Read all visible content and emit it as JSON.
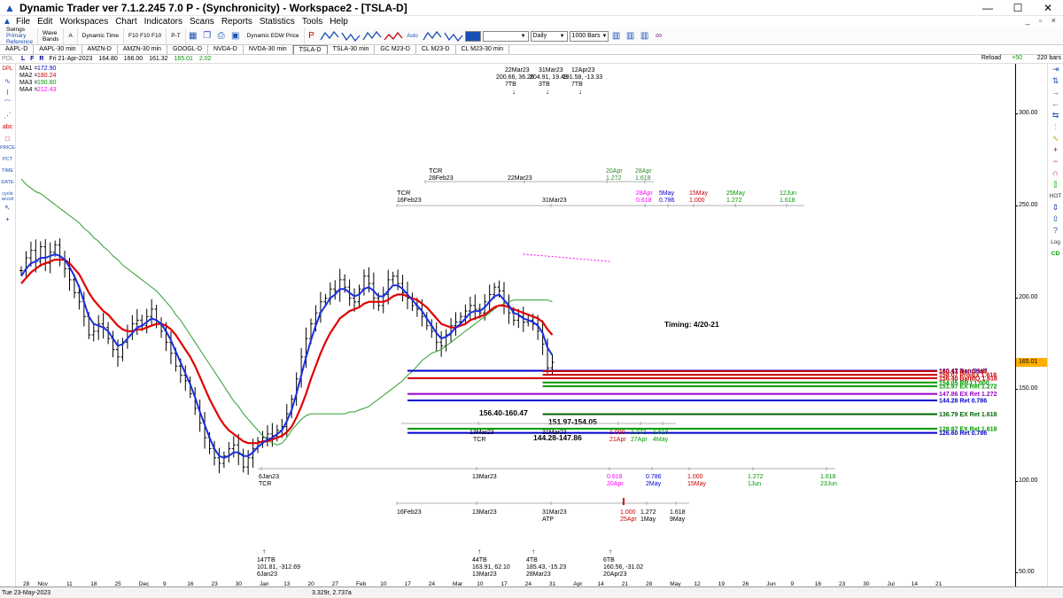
{
  "window": {
    "title": "Dynamic Trader ver 7.1.2.245 7.0 P - (Synchronicity) - Workspace2 - [TSLA-D]",
    "buttons": {
      "minimize": "—",
      "maximize": "☐",
      "close": "✕"
    },
    "mdi_buttons": "_ ▫ ×"
  },
  "menu": [
    "File",
    "Edit",
    "Workspaces",
    "Chart",
    "Indicators",
    "Scans",
    "Reports",
    "Statistics",
    "Tools",
    "Help"
  ],
  "toolbar": {
    "swings_label": "Swings",
    "swings_primary": "Primary",
    "swings_reference": "Reference",
    "wave_label": "Wave",
    "bands_label": "Bands",
    "a_label": "A",
    "dynamic_time": "Dynamic Time",
    "f_labels": "F10 F10 F10",
    "pt_label": "P-T",
    "edw_label": "Dynamic EDW Price",
    "auto_label": "Auto",
    "symbol_input": "",
    "interval": "Daily",
    "bars_value": "1000",
    "bars_label": "Bars",
    "p_label": "P"
  },
  "tabs": [
    "AAPL-D",
    "AAPL-30 min",
    "AMZN-D",
    "AMZN-30 min",
    "GOOGL-D",
    "NVDA-D",
    "NVDA-30 min",
    "TSLA-D",
    "TSLA-30 min",
    "GC M23-D",
    "CL M23-D",
    "CL M23-30 min"
  ],
  "active_tab": "TSLA-D",
  "infobar": {
    "tag": "PDL",
    "lfr": "L F R",
    "date": "Fri 21-Apr-2023",
    "open": "164.80",
    "high": "166.00",
    "low": "161.32",
    "close": "165.01",
    "change": "2.02",
    "reload": "Reload",
    "plus": "+50",
    "bars": "220 bars"
  },
  "lefttools": {
    "dpl": "DPL",
    "abc": "abc",
    "price": "PRICE",
    "pct": "PCT",
    "time": "TIME",
    "date": "DATE",
    "cycle": "cycle accrd"
  },
  "righttools": {
    "log": "Log",
    "cd": "CD",
    "hot": "HOT"
  },
  "statusbar": {
    "date": "Tue 23-May-2023",
    "coords": "3.329r, 2.737a"
  },
  "chart_data": {
    "type": "line",
    "symbol": "TSLA-D",
    "ylim": [
      40,
      320
    ],
    "price_ticks": [
      300,
      250,
      200,
      150,
      100,
      50
    ],
    "price_tick_labels": [
      "300.00",
      "250.00",
      "200.00",
      "150.00",
      "100.00",
      "50.00"
    ],
    "last_price": 165.01,
    "last_price_label": "165.01",
    "x_labels": [
      "28",
      "Nov",
      "11",
      "18",
      "25",
      "Dec",
      "9",
      "16",
      "23",
      "30",
      "Jan",
      "13",
      "20",
      "27",
      "Feb",
      "10",
      "17",
      "24",
      "Mar",
      "10",
      "17",
      "24",
      "31",
      "Apr",
      "14",
      "21",
      "28",
      "May",
      "12",
      "19",
      "26",
      "Jun",
      "9",
      "16",
      "23",
      "30",
      "Jul",
      "14",
      "21"
    ],
    "x_bar_index": [
      0,
      3,
      9,
      14,
      19,
      24,
      29,
      34,
      39,
      44,
      49,
      54,
      59,
      64,
      69,
      74,
      79,
      84,
      89,
      94,
      99,
      104,
      109,
      114,
      119,
      124,
      129,
      134,
      139,
      144,
      149,
      154,
      159,
      164,
      169,
      174,
      179,
      184,
      189
    ],
    "ma_legend": [
      {
        "name": "MA1",
        "value": "172.90",
        "color": "#0000cc"
      },
      {
        "name": "MA2",
        "value": "180.24",
        "color": "#cc0000"
      },
      {
        "name": "MA3",
        "value": "190.80",
        "color": "#009900"
      },
      {
        "name": "MA4",
        "value": "212.43",
        "color": "#ff00ff"
      }
    ],
    "close": [
      215,
      222,
      226,
      220,
      228,
      219,
      225,
      229,
      221,
      216,
      210,
      203,
      198,
      190,
      180,
      182,
      186,
      184,
      178,
      172,
      168,
      176,
      182,
      186,
      188,
      185,
      190,
      194,
      186,
      182,
      176,
      170,
      163,
      158,
      155,
      148,
      140,
      132,
      124,
      118,
      113,
      110,
      114,
      118,
      120,
      115,
      108,
      113,
      118,
      122,
      124,
      126,
      125,
      128,
      130,
      137,
      145,
      156,
      168,
      178,
      186,
      192,
      198,
      200,
      205,
      204,
      210,
      206,
      200,
      198,
      205,
      212,
      208,
      200,
      196,
      202,
      210,
      212,
      208,
      203,
      200,
      196,
      194,
      190,
      185,
      182,
      176,
      174,
      180,
      185,
      187,
      190,
      193,
      196,
      194,
      192,
      198,
      202,
      206,
      204,
      196,
      192,
      188,
      190,
      187,
      188,
      186,
      182,
      175,
      162,
      165
    ],
    "ma1": [
      212,
      216,
      219,
      220,
      222,
      222,
      223,
      224,
      223,
      221,
      217,
      212,
      206,
      198,
      190,
      186,
      185,
      184,
      182,
      178,
      174,
      175,
      178,
      181,
      184,
      185,
      187,
      189,
      188,
      186,
      182,
      177,
      171,
      165,
      159,
      153,
      146,
      138,
      131,
      124,
      118,
      114,
      113,
      114,
      116,
      116,
      114,
      114,
      116,
      119,
      121,
      123,
      124,
      126,
      128,
      133,
      139,
      148,
      158,
      168,
      177,
      185,
      192,
      196,
      200,
      202,
      205,
      205,
      203,
      201,
      202,
      205,
      206,
      204,
      201,
      201,
      204,
      207,
      207,
      205,
      202,
      199,
      196,
      193,
      189,
      185,
      181,
      178,
      179,
      181,
      184,
      186,
      189,
      192,
      193,
      193,
      195,
      198,
      201,
      202,
      199,
      196,
      192,
      191,
      189,
      188,
      187,
      185,
      181,
      173,
      169
    ],
    "ma2": [
      208,
      211,
      214,
      216,
      218,
      219,
      220,
      221,
      221,
      221,
      219,
      216,
      213,
      208,
      203,
      199,
      196,
      193,
      191,
      188,
      185,
      183,
      182,
      182,
      183,
      183,
      184,
      185,
      186,
      186,
      185,
      183,
      180,
      176,
      172,
      168,
      163,
      157,
      151,
      145,
      140,
      135,
      131,
      128,
      126,
      124,
      122,
      121,
      121,
      121,
      122,
      122,
      123,
      124,
      125,
      127,
      130,
      135,
      141,
      148,
      156,
      163,
      170,
      176,
      181,
      185,
      189,
      191,
      193,
      194,
      195,
      197,
      198,
      198,
      198,
      198,
      199,
      201,
      202,
      202,
      201,
      200,
      199,
      197,
      195,
      192,
      189,
      186,
      185,
      184,
      184,
      185,
      186,
      188,
      189,
      190,
      191,
      193,
      195,
      196,
      196,
      195,
      194,
      193,
      192,
      191,
      190,
      189,
      187,
      183,
      180
    ],
    "ma3": [
      265,
      262,
      260,
      258,
      257,
      255,
      253,
      251,
      249,
      247,
      245,
      243,
      241,
      238,
      236,
      233,
      231,
      228,
      226,
      223,
      221,
      218,
      216,
      214,
      212,
      210,
      208,
      206,
      204,
      201,
      198,
      195,
      191,
      188,
      184,
      180,
      176,
      172,
      168,
      164,
      160,
      156,
      152,
      148,
      144,
      141,
      137,
      134,
      131,
      128,
      125,
      123,
      121,
      120,
      121,
      124,
      128,
      131,
      134,
      136,
      137,
      137,
      137,
      137,
      137,
      137,
      137,
      137,
      138,
      138,
      139,
      140,
      141,
      143,
      145,
      147,
      149,
      151,
      153,
      155,
      158,
      160,
      163,
      166,
      168,
      170,
      171,
      172,
      174,
      176,
      178,
      180,
      182,
      184,
      186,
      188,
      190,
      192,
      194,
      196,
      197,
      198,
      199,
      199,
      199,
      199,
      199,
      199,
      199,
      199,
      198
    ],
    "ma4_segment": {
      "from_bar": 104,
      "to_bar": 122,
      "from": 224,
      "to": 220
    },
    "zones": [
      {
        "label": "156.40-160.47",
        "lo": 156.4,
        "hi": 160.47,
        "from_bar": 80,
        "color": "#cc0000"
      },
      {
        "label": "151.97-154.05",
        "lo": 151.97,
        "hi": 154.05,
        "from_bar": 108,
        "color": "#009900"
      },
      {
        "label": "144.28-147.86",
        "lo": 144.28,
        "hi": 147.86,
        "from_bar": 80,
        "color": "#9900cc"
      }
    ],
    "hlines": [
      {
        "price": 160.47,
        "from_bar": 80,
        "color": "#0000cc",
        "label": "160.47 BandHalf"
      },
      {
        "price": 160.2,
        "from_bar": 108,
        "color": "#cc0000",
        "label": "160.13 Ret 0.500"
      },
      {
        "price": 158.3,
        "from_bar": 108,
        "color": "#cc0000",
        "label": "158.07 ProjEx 1.618"
      },
      {
        "price": 156.4,
        "from_bar": 80,
        "color": "#cc0000",
        "label": "156.40 BandQ 1.618"
      },
      {
        "price": 154.05,
        "from_bar": 108,
        "color": "#009900",
        "label": "154.05 RRJ 1.000"
      },
      {
        "price": 151.97,
        "from_bar": 108,
        "color": "#009900",
        "label": "151.97 EX Ret 1.272"
      },
      {
        "price": 147.86,
        "from_bar": 80,
        "color": "#9900cc",
        "label": "147.86 EX Ret 1.272"
      },
      {
        "price": 144.28,
        "from_bar": 80,
        "color": "#0000cc",
        "label": "144.28 Ret 0.786"
      },
      {
        "price": 136.79,
        "from_bar": 108,
        "color": "#006600",
        "label": "136.79 EX Ret 1.618"
      },
      {
        "price": 128.87,
        "from_bar": 80,
        "color": "#009900",
        "label": "128.87 EX Ret 1.618"
      },
      {
        "price": 126.6,
        "from_bar": 80,
        "color": "#0000cc",
        "label": "126.60 Ret 0.786"
      }
    ],
    "annotations": {
      "timing": "Timing: 4/20-21",
      "top_pivots": [
        {
          "date": "22Mar23",
          "value": "200.66, 36.26",
          "tb": "7TB"
        },
        {
          "date": "31Mar23",
          "value": "204.91, 19.49",
          "tb": "3TB"
        },
        {
          "date": "12Apr23",
          "value": "191.58, -13.33",
          "tb": "7TB"
        }
      ],
      "tcr_row1": {
        "tcr": "TCR",
        "d1": "28Feb23",
        "d2": "22Mar23",
        "r1": "20Apr",
        "r1v": "1.272",
        "r2": "28Apr",
        "r2v": "1.618"
      },
      "tcr_row2": {
        "tcr": "TCR",
        "d1": "16Feb23",
        "d2": "31Mar23",
        "targets": [
          {
            "date": "28Apr",
            "ratio": "0.618",
            "color": "#ff00ff"
          },
          {
            "date": "5May",
            "ratio": "0.786",
            "color": "#0000cc"
          },
          {
            "date": "15May",
            "ratio": "1.000",
            "color": "#cc0000"
          },
          {
            "date": "25May",
            "ratio": "1.272",
            "color": "#009900"
          },
          {
            "date": "12Jun",
            "ratio": "1.618",
            "color": "#009900"
          }
        ]
      },
      "mid_row": {
        "d1": "13Mar23",
        "d1b": "TCR",
        "d2": "31Mar23",
        "targets": [
          {
            "date": "21Apr",
            "ratio": "1.000",
            "color": "#cc0000"
          },
          {
            "date": "27Apr",
            "ratio": "1.272",
            "color": "#009900"
          },
          {
            "date": "4May",
            "ratio": "1.618",
            "color": "#009900"
          }
        ]
      },
      "low_row": {
        "d0": "6Jan23",
        "d0b": "TCR",
        "d1": "13Mar23",
        "targets": [
          {
            "date": "20Apr",
            "ratio": "0.618",
            "color": "#ff00ff"
          },
          {
            "date": "2May",
            "ratio": "0.786",
            "color": "#0000cc"
          },
          {
            "date": "15May",
            "ratio": "1.000",
            "color": "#cc0000"
          },
          {
            "date": "1Jun",
            "ratio": "1.272",
            "color": "#009900"
          },
          {
            "date": "23Jun",
            "ratio": "1.618",
            "color": "#009900"
          }
        ]
      },
      "atp_row": {
        "d0": "16Feb23",
        "d1": "13Mar23",
        "d2": "31Mar23",
        "d2b": "ATP",
        "targets": [
          {
            "date": "25Apr",
            "ratio": "1.000",
            "color": "#cc0000"
          },
          {
            "date": "1May",
            "ratio": "1.272",
            "color": "#000000"
          },
          {
            "date": "9May",
            "ratio": "1.618",
            "color": "#000000"
          }
        ]
      },
      "bottom_pivots": [
        {
          "tb": "147TB",
          "value": "101.81, -312.69",
          "date": "6Jan23"
        },
        {
          "tb": "44TB",
          "value": "163.91, 62.10",
          "date": "13Mar23"
        },
        {
          "tb": "4TB",
          "value": "185.43, -15.23",
          "date": "28Mar23"
        },
        {
          "tb": "6TB",
          "value": "160.56, -31.02",
          "date": "20Apr23"
        }
      ]
    }
  }
}
